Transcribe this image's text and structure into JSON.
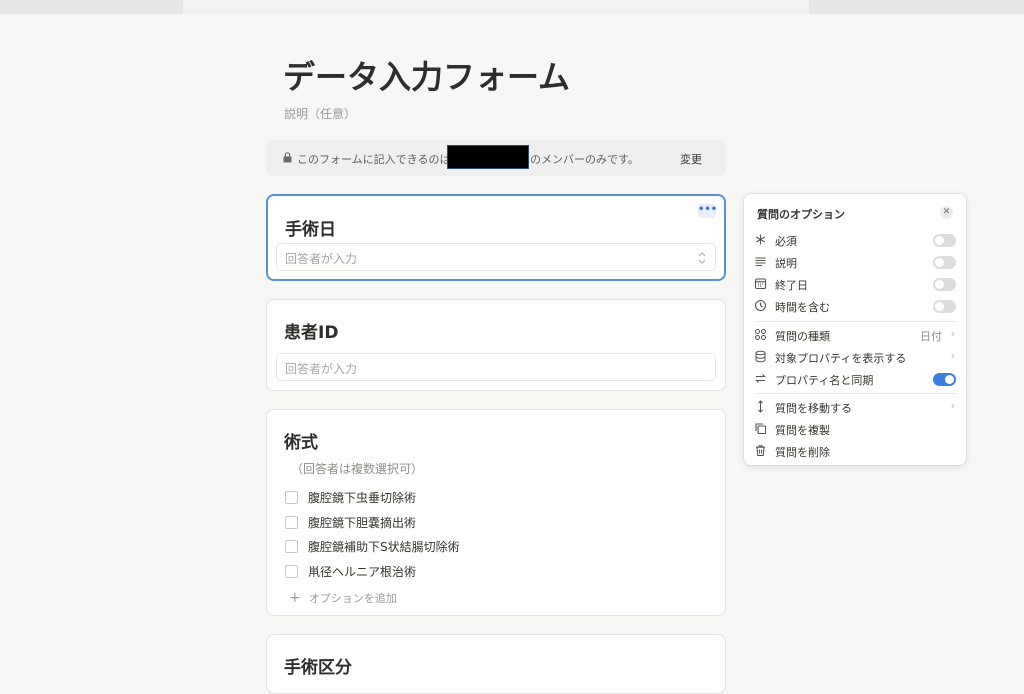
{
  "form": {
    "title": "データ入力フォーム",
    "description": "説明（任意）"
  },
  "notice": {
    "text_before": "このフォームに記入できるのは",
    "text_after": "のメンバーのみです。",
    "change_label": "変更"
  },
  "questions": [
    {
      "title": "手術日",
      "placeholder": "回答者が入力"
    },
    {
      "title": "患者ID",
      "placeholder": "回答者が入力"
    },
    {
      "title": "術式",
      "hint": "（回答者は複数選択可）",
      "options": [
        "腹腔鏡下虫垂切除術",
        "腹腔鏡下胆嚢摘出術",
        "腹腔鏡補助下S状結腸切除術",
        "鼡径ヘルニア根治術"
      ],
      "add_option": "オプションを追加"
    },
    {
      "title": "手術区分"
    }
  ],
  "options_panel": {
    "title": "質問のオプション",
    "toggles": [
      {
        "label": "必須",
        "icon": "asterisk-icon",
        "on": false
      },
      {
        "label": "説明",
        "icon": "text-lines-icon",
        "on": false
      },
      {
        "label": "終了日",
        "icon": "calendar-icon",
        "on": false
      },
      {
        "label": "時間を含む",
        "icon": "clock-icon",
        "on": false
      }
    ],
    "type_row": {
      "label": "質問の種類",
      "value": "日付",
      "icon": "grid-icon"
    },
    "show_property_label": "対象プロパティを表示する",
    "sync_label": "プロパティ名と同期",
    "sync_on": true,
    "move_label": "質問を移動する",
    "duplicate_label": "質問を複製",
    "delete_label": "質問を削除"
  },
  "colors": {
    "accent": "#3d7fe0",
    "selected_border": "#5a8fd8"
  }
}
